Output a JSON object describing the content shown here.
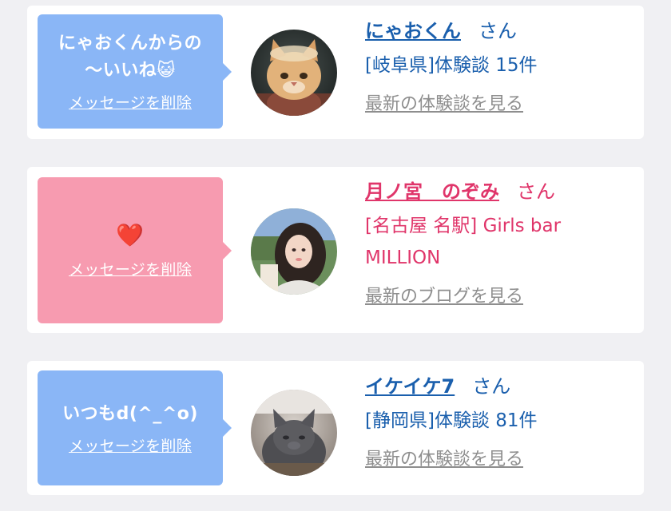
{
  "likes": [
    {
      "message": "にゃおくんからの",
      "message2": "〜いいね",
      "message_emoji": "😺",
      "delete_label": "メッセージを削除",
      "name": "にゃおくん",
      "honorific": "さん",
      "detail": "[岐阜県]体験談 15件",
      "link_label": "最新の体験談を見る",
      "bubble_color": "#8ab6f6",
      "text_color": "#1a5fad",
      "avatar_icon": "orange-cat-avatar"
    },
    {
      "message_emoji": "❤️",
      "delete_label": "メッセージを削除",
      "name": "月ノ宮　のぞみ",
      "honorific": "さん",
      "detail": "[名古屋 名駅] Girls bar",
      "detail2": "MILLION",
      "link_label": "最新のブログを見る",
      "bubble_color": "#f79bb0",
      "text_color": "#e0356a",
      "avatar_icon": "woman-photo-avatar"
    },
    {
      "message": "いつもd(^_^o)",
      "delete_label": "メッセージを削除",
      "name": "イケイケ7",
      "honorific": "さん",
      "detail": "[静岡県]体験談 81件",
      "link_label": "最新の体験談を見る",
      "bubble_color": "#8ab6f6",
      "text_color": "#1a5fad",
      "avatar_icon": "gray-kitten-avatar"
    }
  ]
}
